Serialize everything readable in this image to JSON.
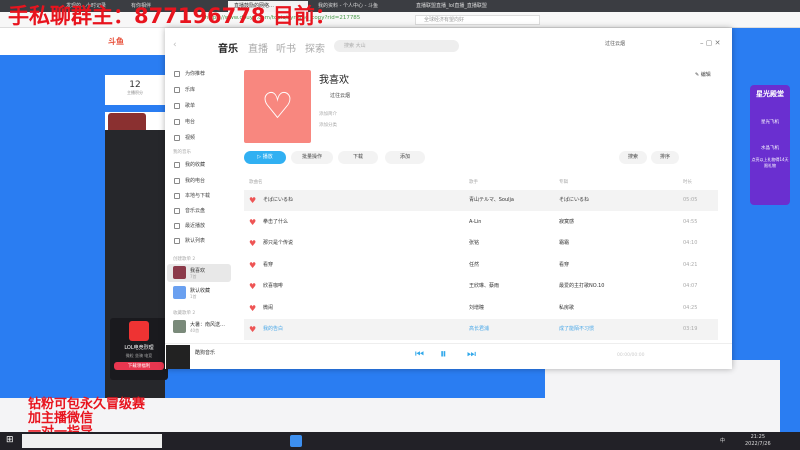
{
  "browser": {
    "tabs": [
      "发现的…小时记录",
      "有你相伴",
      "直播鼓励的网络…",
      "我的资料 - 个人中心 - 斗鱼",
      "直播联盟直播_lol直播_直播联盟"
    ],
    "url": "https://www.douyu.com/topic/synsmd_copy?rid=217785",
    "search_placeholder": "全球经济有望向好"
  },
  "overlay": {
    "top_text": "手私聊群主：877196778    目前：",
    "bottom_lines": [
      "钻粉可包永久冒级赛",
      "加主播微信",
      "一对一指导"
    ]
  },
  "douyu": {
    "logo": "斗鱼",
    "stat_value": "12",
    "stat_label": "主播积分",
    "streamer_name": "LOL电竞烈理",
    "streamer_btns": [
      "微粒",
      "坐骑",
      "电竞"
    ],
    "download_btn": "下载领福利",
    "promo_title": "星光殿堂",
    "promo_items": [
      "星光飞机",
      "水晶飞机"
    ],
    "promo_note": "点亮以上礼物得14天限礼物"
  },
  "music": {
    "nav": [
      "音乐",
      "直播",
      "听书",
      "探索"
    ],
    "search_placeholder": "搜索 大山",
    "user": "过往云烟",
    "sidebar": {
      "items": [
        "为你推荐",
        "乐库",
        "歌单",
        "电台",
        "视频"
      ],
      "my_label": "我的音乐",
      "my_items": [
        "我的收藏",
        "我的电台",
        "本地与下载",
        "音乐云盘",
        "最近播放",
        "默认列表"
      ],
      "created_label": "创建歌单 2",
      "created": [
        {
          "name": "我喜欢",
          "count": "7首"
        },
        {
          "name": "默认收藏",
          "count": "1首"
        }
      ],
      "fav_label": "收藏歌单 2",
      "fav": [
        {
          "name": "大暑：南风送…",
          "count": "40首"
        }
      ]
    },
    "playlist": {
      "title": "我喜欢",
      "owner": "过往云烟",
      "add_intro": "添加简介",
      "add_tag": "添加分类",
      "edit": "编辑",
      "buttons": [
        "播放",
        "批量操作",
        "下载",
        "添加"
      ],
      "search": "搜索",
      "sort": "排序"
    },
    "columns": [
      "歌曲名",
      "歌手",
      "专辑",
      "时长"
    ],
    "songs": [
      {
        "name": "そばにいるね",
        "artist": "青山テルマ、Soulja",
        "album": "そばにいるね",
        "duration": "05:05"
      },
      {
        "name": "拳击了什么",
        "artist": "A-Lin",
        "album": "寂寞感",
        "duration": "04:55"
      },
      {
        "name": "那只是个传说",
        "artist": "张铭",
        "album": "霜霜",
        "duration": "04:10"
      },
      {
        "name": "看穿",
        "artist": "任然",
        "album": "看穿",
        "duration": "04:21"
      },
      {
        "name": "欣喜咖啡",
        "artist": "王欣琳、蔡雨",
        "album": "最爱的主打歌NO.10",
        "duration": "04:07"
      },
      {
        "name": "微闹",
        "artist": "刘增瞳",
        "album": "私房歌",
        "duration": "04:25"
      },
      {
        "name": "我的告白",
        "artist": "高长君浦",
        "album": "成了能陌不习惯",
        "duration": "03:19"
      }
    ],
    "player": {
      "title": "酷狗音乐",
      "time": "00:00/00:00"
    }
  },
  "taskbar": {
    "time": "21:25",
    "date": "2022/7/26",
    "ime": "中"
  }
}
